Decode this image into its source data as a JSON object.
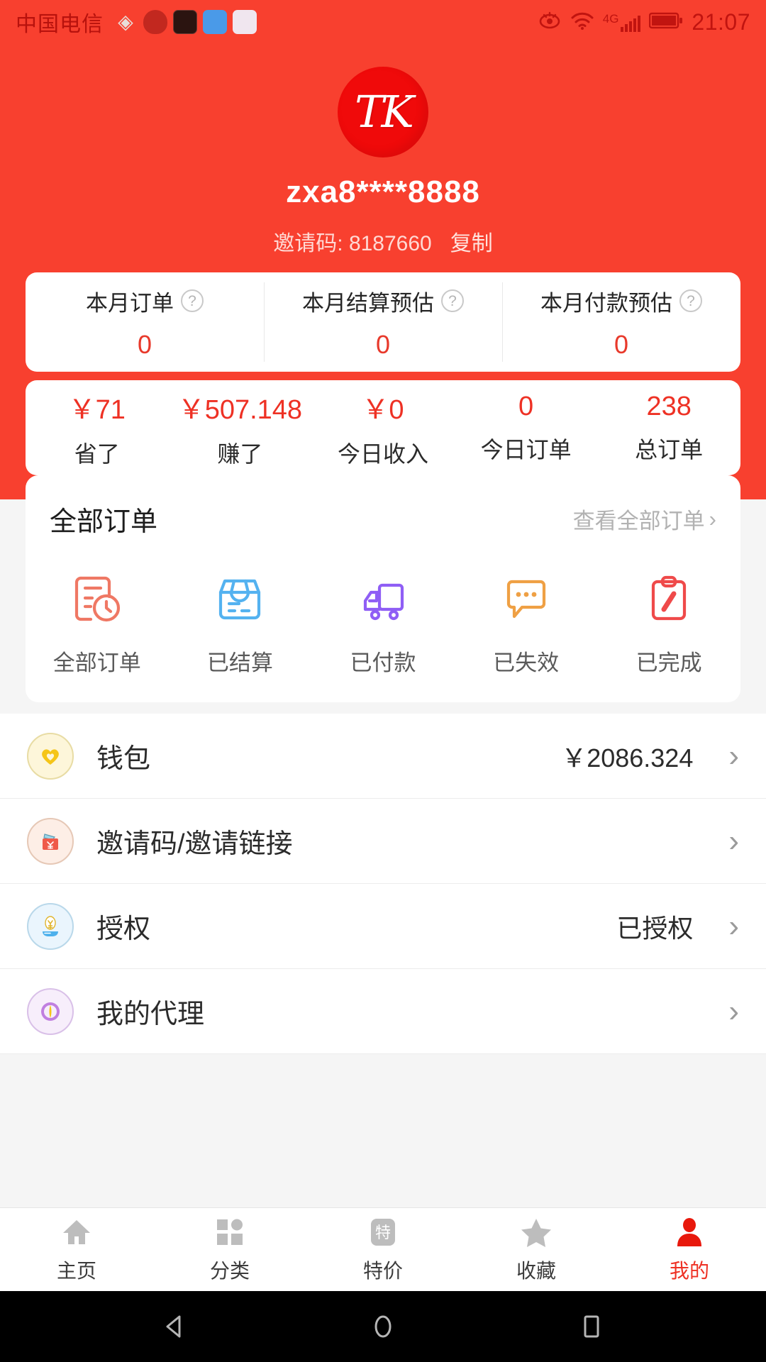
{
  "status_bar": {
    "carrier": "中国电信",
    "time": "21:07",
    "network": "4G",
    "app_icons": [
      "feather-app-icon",
      "weather-app-icon",
      "red-book-app-icon",
      "blue-bird-app-icon",
      "wave-app-icon"
    ],
    "indicators": [
      "eye-comfort-icon",
      "wifi-icon",
      "signal-icon",
      "battery-icon"
    ]
  },
  "header": {
    "avatar_text": "TK",
    "username": "zxa8****8888",
    "invite_label": "邀请码:",
    "invite_code": "8187660",
    "copy_label": "复制",
    "accent_color": "#f8402f"
  },
  "month_cards": [
    {
      "label": "本月订单",
      "value": "0"
    },
    {
      "label": "本月结算预估",
      "value": "0"
    },
    {
      "label": "本月付款预估",
      "value": "0"
    }
  ],
  "stats": [
    {
      "value": "￥71",
      "label": "省了"
    },
    {
      "value": "￥507.148",
      "label": "赚了"
    },
    {
      "value": "￥0",
      "label": "今日收入"
    },
    {
      "value": "0",
      "label": "今日订单"
    },
    {
      "value": "238",
      "label": "总订单"
    }
  ],
  "orders": {
    "title": "全部订单",
    "more_label": "查看全部订单",
    "items": [
      {
        "label": "全部订单",
        "icon": "order-list-clock-icon",
        "color": "#ef7864"
      },
      {
        "label": "已结算",
        "icon": "package-box-icon",
        "color": "#54b2f0"
      },
      {
        "label": "已付款",
        "icon": "delivery-truck-icon",
        "color": "#8f5ef5"
      },
      {
        "label": "已失效",
        "icon": "speech-bubble-icon",
        "color": "#efa044"
      },
      {
        "label": "已完成",
        "icon": "clipboard-check-icon",
        "color": "#ef4a4a"
      }
    ]
  },
  "menu": [
    {
      "label": "钱包",
      "value": "￥2086.324",
      "icon": "heart-wallet-icon"
    },
    {
      "label": "邀请码/邀请链接",
      "value": "",
      "icon": "money-bag-icon"
    },
    {
      "label": "授权",
      "value": "已授权",
      "icon": "hand-yen-icon"
    },
    {
      "label": "我的代理",
      "value": "",
      "icon": "agent-circle-icon"
    }
  ],
  "tabbar": [
    {
      "label": "主页",
      "icon": "home-icon",
      "active": false
    },
    {
      "label": "分类",
      "icon": "grid-icon",
      "active": false
    },
    {
      "label": "特价",
      "icon": "special-price-icon",
      "active": false
    },
    {
      "label": "收藏",
      "icon": "star-icon",
      "active": false
    },
    {
      "label": "我的",
      "icon": "person-icon",
      "active": true
    }
  ],
  "android_nav": [
    "back-triangle-icon",
    "home-circle-icon",
    "recents-square-icon"
  ]
}
